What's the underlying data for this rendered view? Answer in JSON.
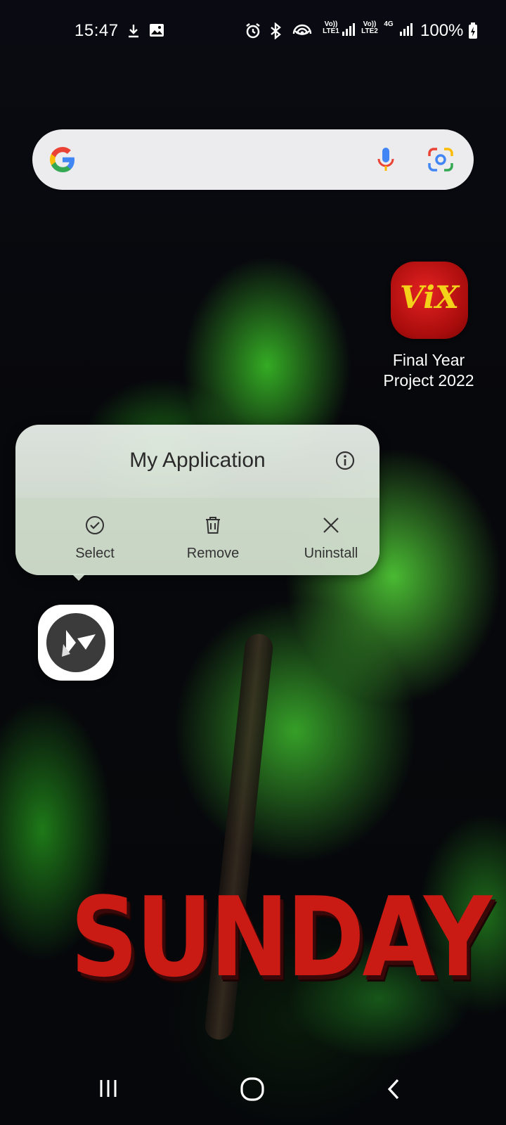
{
  "status_bar": {
    "time": "15:47",
    "sim1_label": "Vo))\nLTE1",
    "sim2_label": "Vo))\nLTE2",
    "network_type": "4G",
    "battery": "100%",
    "icons": [
      "download-icon",
      "image-icon",
      "alarm-icon",
      "bluetooth-icon",
      "hotspot-icon",
      "signal-icon",
      "battery-charging-icon"
    ]
  },
  "search_bar": {
    "icons": [
      "google-logo",
      "mic-icon",
      "lens-icon"
    ]
  },
  "home_apps": [
    {
      "name": "Final Year Project 2022",
      "icon_text": "ViX",
      "icon_color": "#c81414",
      "accent": "#f5d21a"
    }
  ],
  "context_menu": {
    "title": "My Application",
    "info_icon": "info-icon",
    "actions": [
      {
        "label": "Select",
        "icon": "check-circle-icon"
      },
      {
        "label": "Remove",
        "icon": "trash-icon"
      },
      {
        "label": "Uninstall",
        "icon": "close-icon"
      }
    ]
  },
  "wallpaper": {
    "text": "SUNDAY",
    "color": "#c91a14"
  },
  "nav_bar": {
    "buttons": [
      "recents-icon",
      "home-icon",
      "back-icon"
    ]
  }
}
